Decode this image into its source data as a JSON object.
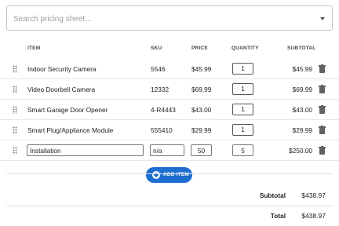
{
  "search": {
    "placeholder": "Search pricing sheet...",
    "value": ""
  },
  "table": {
    "headers": {
      "item": "ITEM",
      "sku": "SKU",
      "price": "PRICE",
      "quantity": "QUANTITY",
      "subtotal": "SUBTOTAL"
    },
    "rows": [
      {
        "item": "Indoor Security Camera",
        "sku": "5546",
        "price": "$45.99",
        "quantity": "1",
        "subtotal": "$45.99"
      },
      {
        "item": "Video Doorbell Camera",
        "sku": "12332",
        "price": "$69.99",
        "quantity": "1",
        "subtotal": "$69.99"
      },
      {
        "item": "Smart Garage Door Opener",
        "sku": "4-R4443",
        "price": "$43.00",
        "quantity": "1",
        "subtotal": "$43.00"
      },
      {
        "item": "Smart Plug/Appliance Module",
        "sku": "555410",
        "price": "$29.99",
        "quantity": "1",
        "subtotal": "$29.99"
      }
    ],
    "edit_row": {
      "item": "Installation",
      "sku": "n/a",
      "price": "50",
      "quantity": "5",
      "subtotal": "$250.00"
    }
  },
  "add_button": {
    "label": "ADD ITEM"
  },
  "totals": {
    "subtotal_label": "Subtotal",
    "subtotal_value": "$438.97",
    "total_label": "Total",
    "total_value": "$438.97"
  },
  "colors": {
    "accent": "#1e6ed2",
    "icon": "#616161",
    "border": "#c4c4c4"
  }
}
